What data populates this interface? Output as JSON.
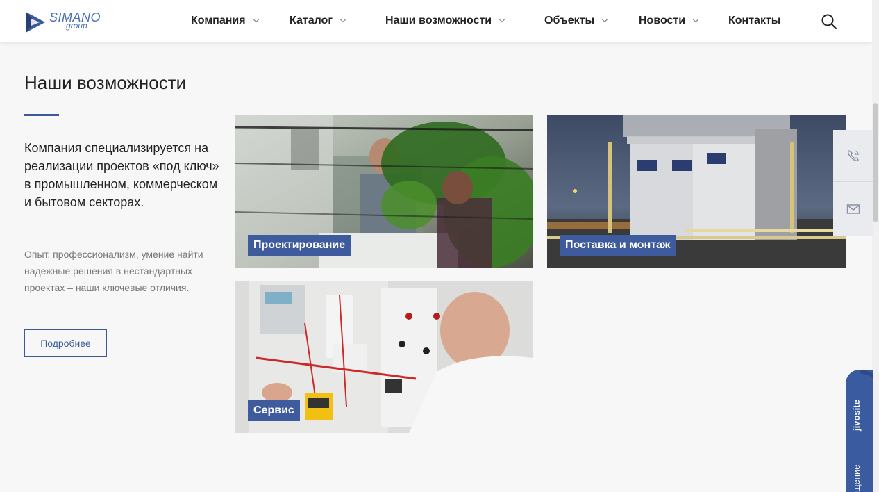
{
  "header": {
    "logo_text": "SIMANO",
    "logo_sub": "group",
    "nav": [
      {
        "label": "Компания",
        "dropdown": true
      },
      {
        "label": "Каталог",
        "dropdown": true
      },
      {
        "label": "Наши возможности",
        "dropdown": true
      },
      {
        "label": "Объекты",
        "dropdown": true
      },
      {
        "label": "Новости",
        "dropdown": true
      },
      {
        "label": "Контакты",
        "dropdown": false
      }
    ],
    "search_icon": "search-icon"
  },
  "main": {
    "title": "Наши возможности",
    "lead": "Компания специализируется на реализации проектов «под ключ» в промышленном, коммерческом и бытовом секторах.",
    "description": "Опыт, профессионализм, умение найти надежные решения в нестандартных проектах – наши ключевые отличия.",
    "more_button": "Подробнее",
    "cards": [
      {
        "label": "Проектирование"
      },
      {
        "label": "Поставка и монтаж"
      },
      {
        "label": "Сервис"
      }
    ]
  },
  "side_widget": {
    "phone_icon": "phone-icon",
    "mail_icon": "mail-icon"
  },
  "jivo": {
    "brand": "jivosite",
    "message": "щение"
  },
  "colors": {
    "accent": "#3c5a9a",
    "label_bg": "#3e5b9e",
    "jivo": "#3a5ba0"
  }
}
